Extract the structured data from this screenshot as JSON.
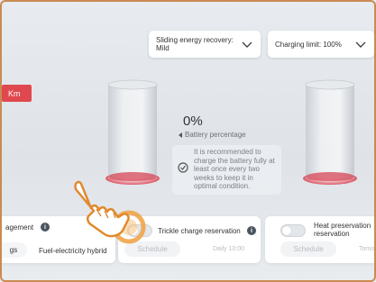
{
  "dropdowns": {
    "energy_recovery": {
      "label": "Sliding energy recovery:",
      "value": "Mild"
    },
    "charging_limit": {
      "label": "Charging limit: 100%"
    }
  },
  "badge": {
    "unit": "Km"
  },
  "battery": {
    "percentage_value": "0%",
    "percentage_label": "Battery percentage",
    "tip": "It is recommended to charge the battery fully at least once every two weeks to keep it in optimal condition."
  },
  "cards": {
    "management": {
      "title": "agement",
      "left_partial": "gs",
      "mode": "Fuel-electricity hybrid"
    },
    "trickle": {
      "title": "Trickle charge reservation",
      "schedule_label": "Schedule",
      "time": "Daily 10:00"
    },
    "heat": {
      "title": "Heat preservation reservation",
      "schedule_label": "Schedule",
      "time_partial": "Tomo"
    }
  },
  "colors": {
    "accent_orange": "#f0a040",
    "badge_red": "#e0484f",
    "battery_glow": "#e05060"
  },
  "icons": [
    "chevron-down-icon",
    "info-icon",
    "battery-icon",
    "tip-icon",
    "pointing-hand-icon"
  ]
}
